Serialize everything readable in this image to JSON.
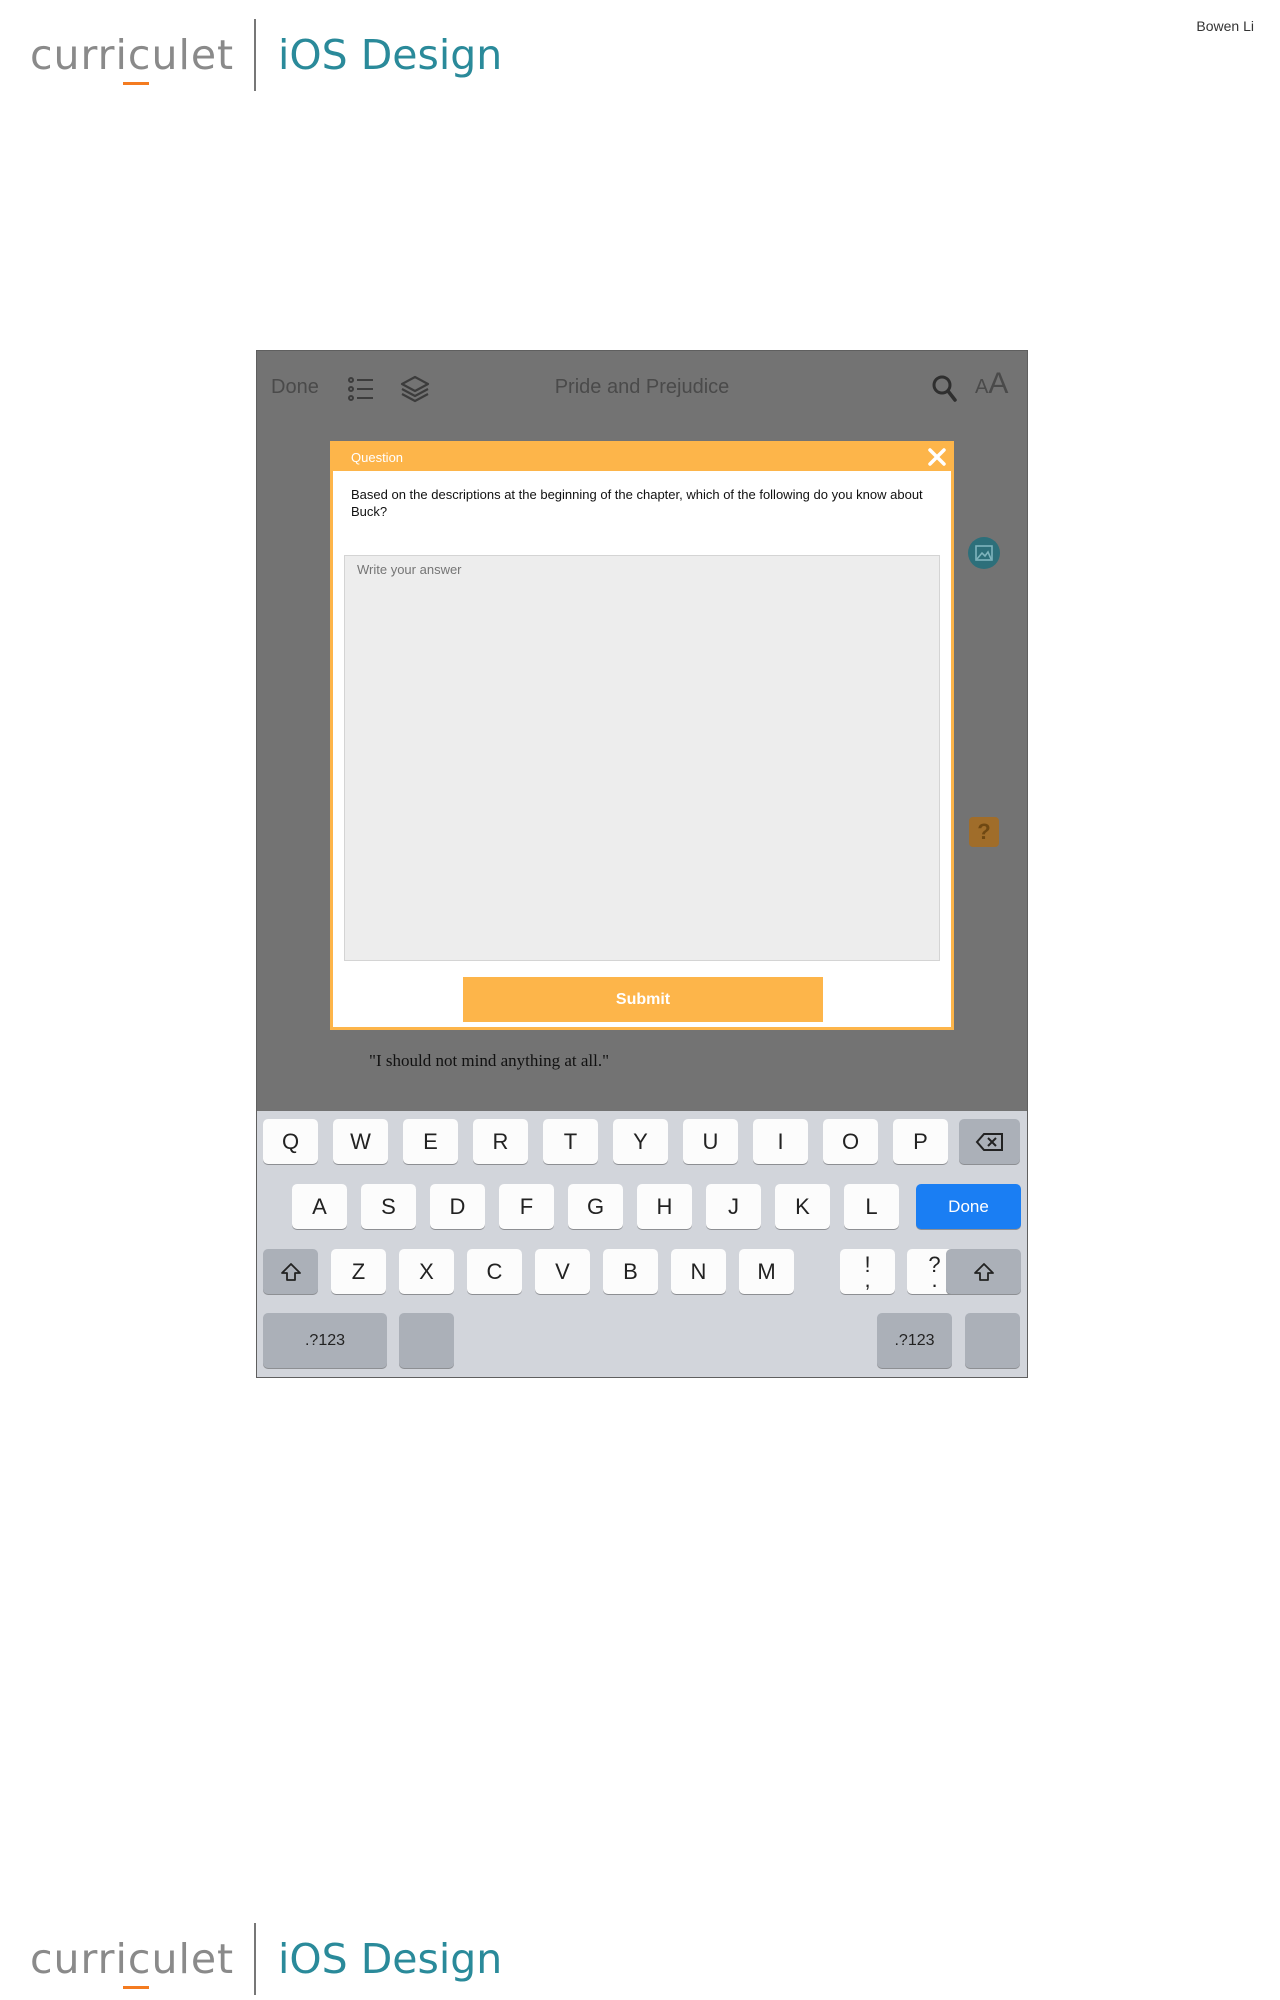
{
  "brand": {
    "logo": "curriculet",
    "product": "iOS Design"
  },
  "author": "Bowen Li",
  "navbar": {
    "done_label": "Done",
    "title": "Pride and Prejudice"
  },
  "book": {
    "quote": "\"I should not mind anything at all.\""
  },
  "modal": {
    "header_label": "Question",
    "question": "Based on the descriptions at the beginning of the chapter, which of the following do you know about Buck?",
    "answer_placeholder": "Write your answer",
    "submit_label": "Submit"
  },
  "keyboard": {
    "row1": [
      "Q",
      "W",
      "E",
      "R",
      "T",
      "Y",
      "U",
      "I",
      "O",
      "P"
    ],
    "row2": [
      "A",
      "S",
      "D",
      "F",
      "G",
      "H",
      "J",
      "K",
      "L"
    ],
    "row3": [
      "Z",
      "X",
      "C",
      "V",
      "B",
      "N",
      "M"
    ],
    "done_label": "Done",
    "numbers_label": ".?123",
    "punct1_top": "!",
    "punct1_bottom": ",",
    "punct2_top": "?",
    "punct2_bottom": "."
  },
  "colors": {
    "accent_orange": "#fdb54a",
    "brand_teal": "#2a8a9a",
    "keyboard_blue": "#1a7ef3"
  }
}
